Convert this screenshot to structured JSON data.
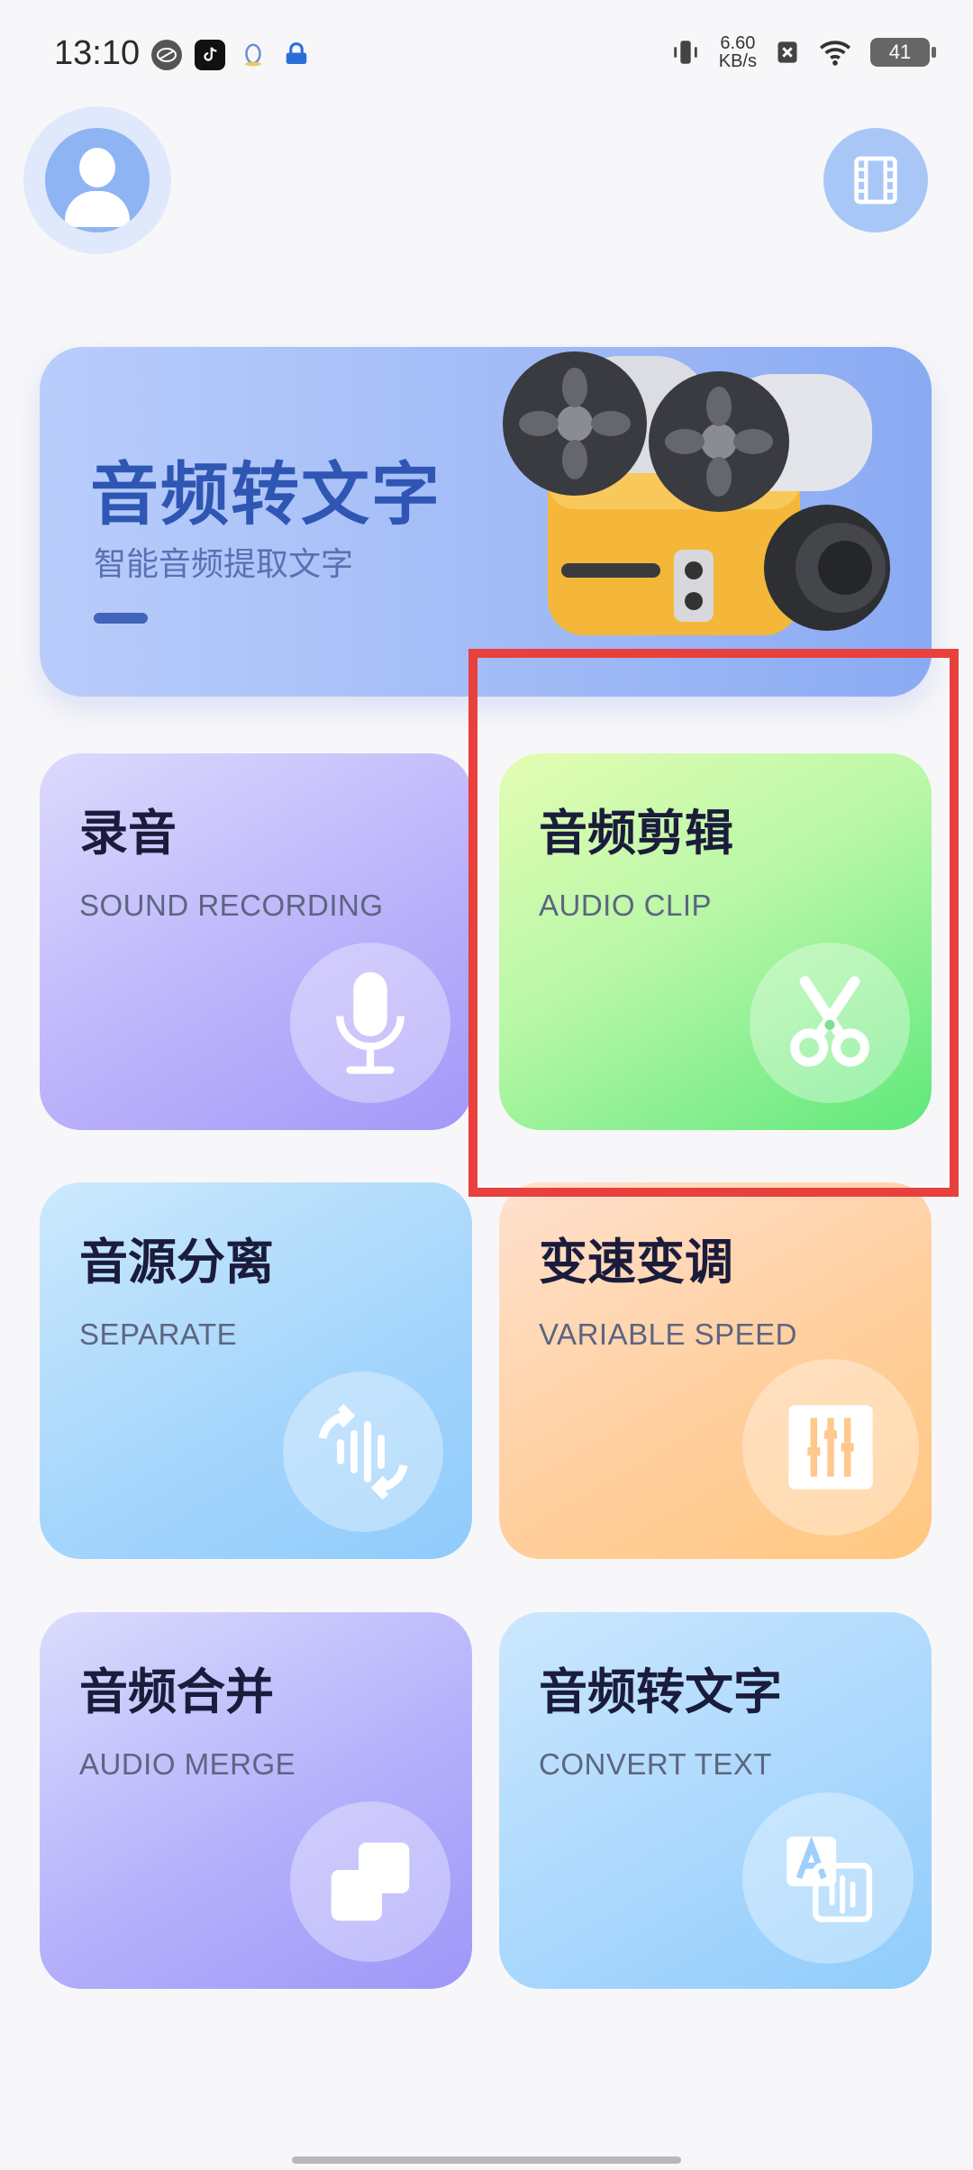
{
  "status_bar": {
    "time": "13:10",
    "net_speed_value": "6.60",
    "net_speed_unit": "KB/s",
    "battery": "41",
    "left_icons": [
      "speed-app-icon",
      "tiktok-icon",
      "qq-icon",
      "lock-app-icon"
    ],
    "right_icons": [
      "vibrate-icon",
      "no-sim-icon",
      "wifi-icon",
      "battery-icon"
    ]
  },
  "header": {
    "avatar_icon": "user-icon",
    "film_icon": "film-icon"
  },
  "hero": {
    "title": "音频转文字",
    "subtitle": "智能音频提取文字",
    "illustration": "film-projector-icon"
  },
  "cards": [
    {
      "title": "录音",
      "subtitle": "SOUND RECORDING",
      "icon": "microphone-icon"
    },
    {
      "title": "音频剪辑",
      "subtitle": "AUDIO CLIP",
      "icon": "scissors-icon"
    },
    {
      "title": "音源分离",
      "subtitle": "SEPARATE",
      "icon": "waveform-icon"
    },
    {
      "title": "变速变调",
      "subtitle": "VARIABLE SPEED",
      "icon": "sliders-icon"
    },
    {
      "title": "音频合并",
      "subtitle": "AUDIO MERGE",
      "icon": "merge-icon"
    },
    {
      "title": "音频转文字",
      "subtitle": "CONVERT TEXT",
      "icon": "translate-icon"
    }
  ],
  "colors": {
    "highlight": "#e8403c",
    "hero_title": "#2f56b3",
    "background": "#f7f7f9"
  }
}
